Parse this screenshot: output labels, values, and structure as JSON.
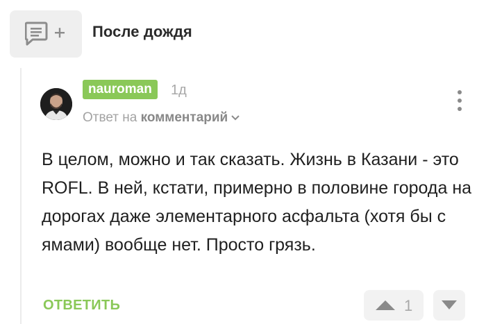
{
  "post": {
    "title": "После дождя",
    "thumb_icon": "comment-add-icon"
  },
  "comment": {
    "author": "nauroman",
    "time": "1д",
    "reply_prefix": "Ответ на",
    "reply_target": "комментарий",
    "text": "В целом, можно и так сказать. Жизнь в Казани - это ROFL. В ней, кстати, примерно в половине города на дорогах даже элементарного асфальта (хотя бы с ямами) вообще нет. Просто грязь.",
    "reply_label": "ОТВЕТИТЬ",
    "rating": "1"
  },
  "colors": {
    "accent_green": "#8ac858",
    "muted": "#a8a8a8",
    "button_bg": "#f2f2f2"
  }
}
